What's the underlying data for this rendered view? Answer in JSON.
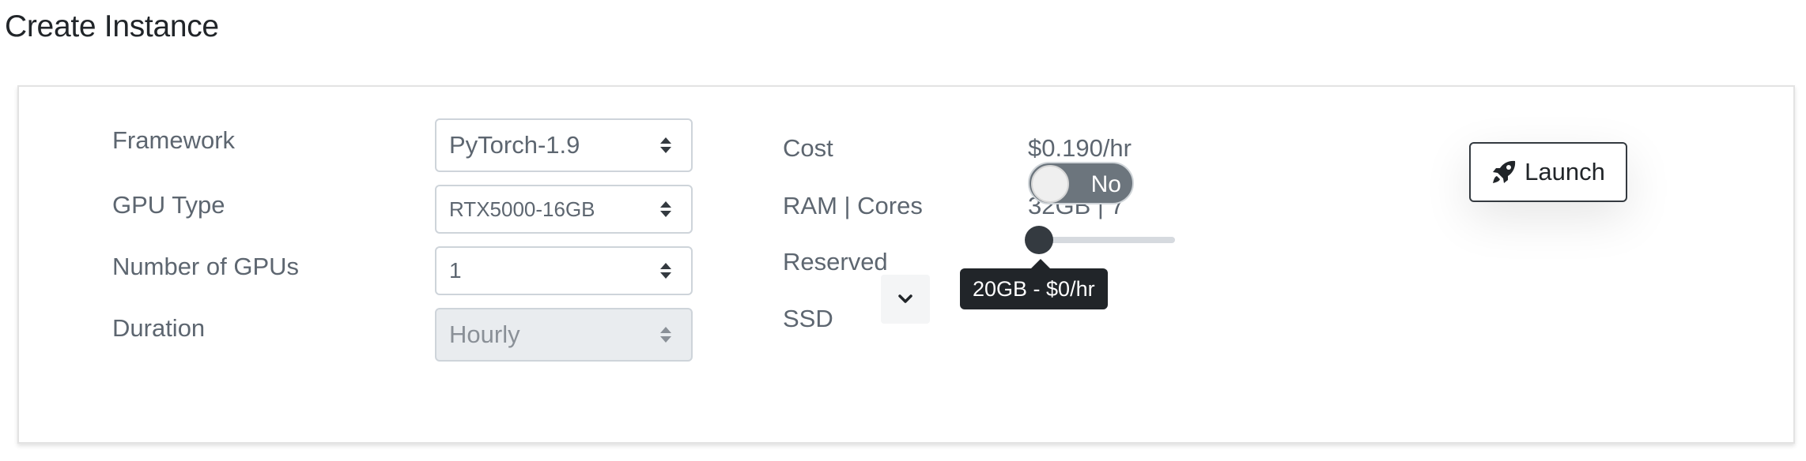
{
  "page": {
    "title": "Create Instance"
  },
  "form": {
    "framework": {
      "label": "Framework",
      "value": "PyTorch-1.9"
    },
    "gpu_type": {
      "label": "GPU Type",
      "value": "RTX5000-16GB"
    },
    "num_gpus": {
      "label": "Number of GPUs",
      "value": "1"
    },
    "duration": {
      "label": "Duration",
      "value": "Hourly",
      "disabled": true
    }
  },
  "summary": {
    "cost": {
      "label": "Cost",
      "value": "$0.190/hr"
    },
    "ram_cores": {
      "label": "RAM | Cores",
      "value": "32GB | 7"
    },
    "reserved": {
      "label": "Reserved",
      "toggle_text": "No",
      "checked": false
    },
    "ssd": {
      "label": "SSD",
      "tooltip": "20GB - $0/hr",
      "slider_level": 0
    }
  },
  "actions": {
    "launch_label": "Launch",
    "expand_icon": "chevron-down-icon",
    "launch_icon": "rocket-icon"
  },
  "colors": {
    "text": "#212529",
    "muted": "#5d6670",
    "toggle_off": "#6c757d",
    "dark": "#343a40"
  }
}
